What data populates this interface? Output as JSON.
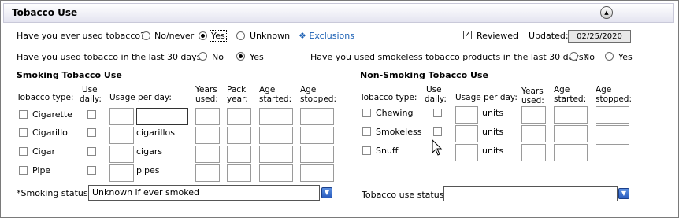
{
  "section": {
    "title": "Tobacco Use",
    "collapse_icon": "chevron-up-icon"
  },
  "q1": {
    "label": "Have you ever used tobacco?",
    "options": [
      "No/never",
      "Yes",
      "Unknown"
    ],
    "selected": "Yes"
  },
  "exclusions": {
    "label": "Exclusions",
    "icon": "diamond-icon"
  },
  "reviewed": {
    "label": "Reviewed",
    "checked": true
  },
  "updated": {
    "label": "Updated:",
    "value": "02/25/2020"
  },
  "q2": {
    "label": "Have you used tobacco in the last 30 days?",
    "options": [
      "No",
      "Yes"
    ],
    "selected": "Yes"
  },
  "q3": {
    "label": "Have you used smokeless tobacco products in the last 30 days?",
    "options": [
      "No",
      "Yes"
    ],
    "selected": null
  },
  "smoking": {
    "title": "Smoking Tobacco Use",
    "headers": {
      "type": "Tobacco type:",
      "use_daily": [
        "Use",
        "daily:"
      ],
      "usage": "Usage per day:",
      "years": [
        "Years",
        "used:"
      ],
      "pack": [
        "Pack",
        "year:"
      ],
      "age_started": [
        "Age",
        "started:"
      ],
      "age_stopped": [
        "Age",
        "stopped:"
      ]
    },
    "rows": [
      {
        "label": "Cigarette",
        "unit": ""
      },
      {
        "label": "Cigarillo",
        "unit": "cigarillos"
      },
      {
        "label": "Cigar",
        "unit": "cigars"
      },
      {
        "label": "Pipe",
        "unit": "pipes"
      }
    ],
    "status_label": "*Smoking status:",
    "status_value": "Unknown if ever smoked"
  },
  "nonsmoking": {
    "title": "Non-Smoking Tobacco Use",
    "headers": {
      "type": "Tobacco type:",
      "use_daily": [
        "Use",
        "daily:"
      ],
      "usage": "Usage per day:",
      "years": [
        "Years",
        "used:"
      ],
      "age_started": [
        "Age",
        "started:"
      ],
      "age_stopped": [
        "Age",
        "stopped:"
      ]
    },
    "rows": [
      {
        "label": "Chewing",
        "unit": "units"
      },
      {
        "label": "Smokeless",
        "unit": "units"
      },
      {
        "label": "Snuff",
        "unit": "units"
      }
    ],
    "status_label": "Tobacco use status:",
    "status_value": ""
  }
}
